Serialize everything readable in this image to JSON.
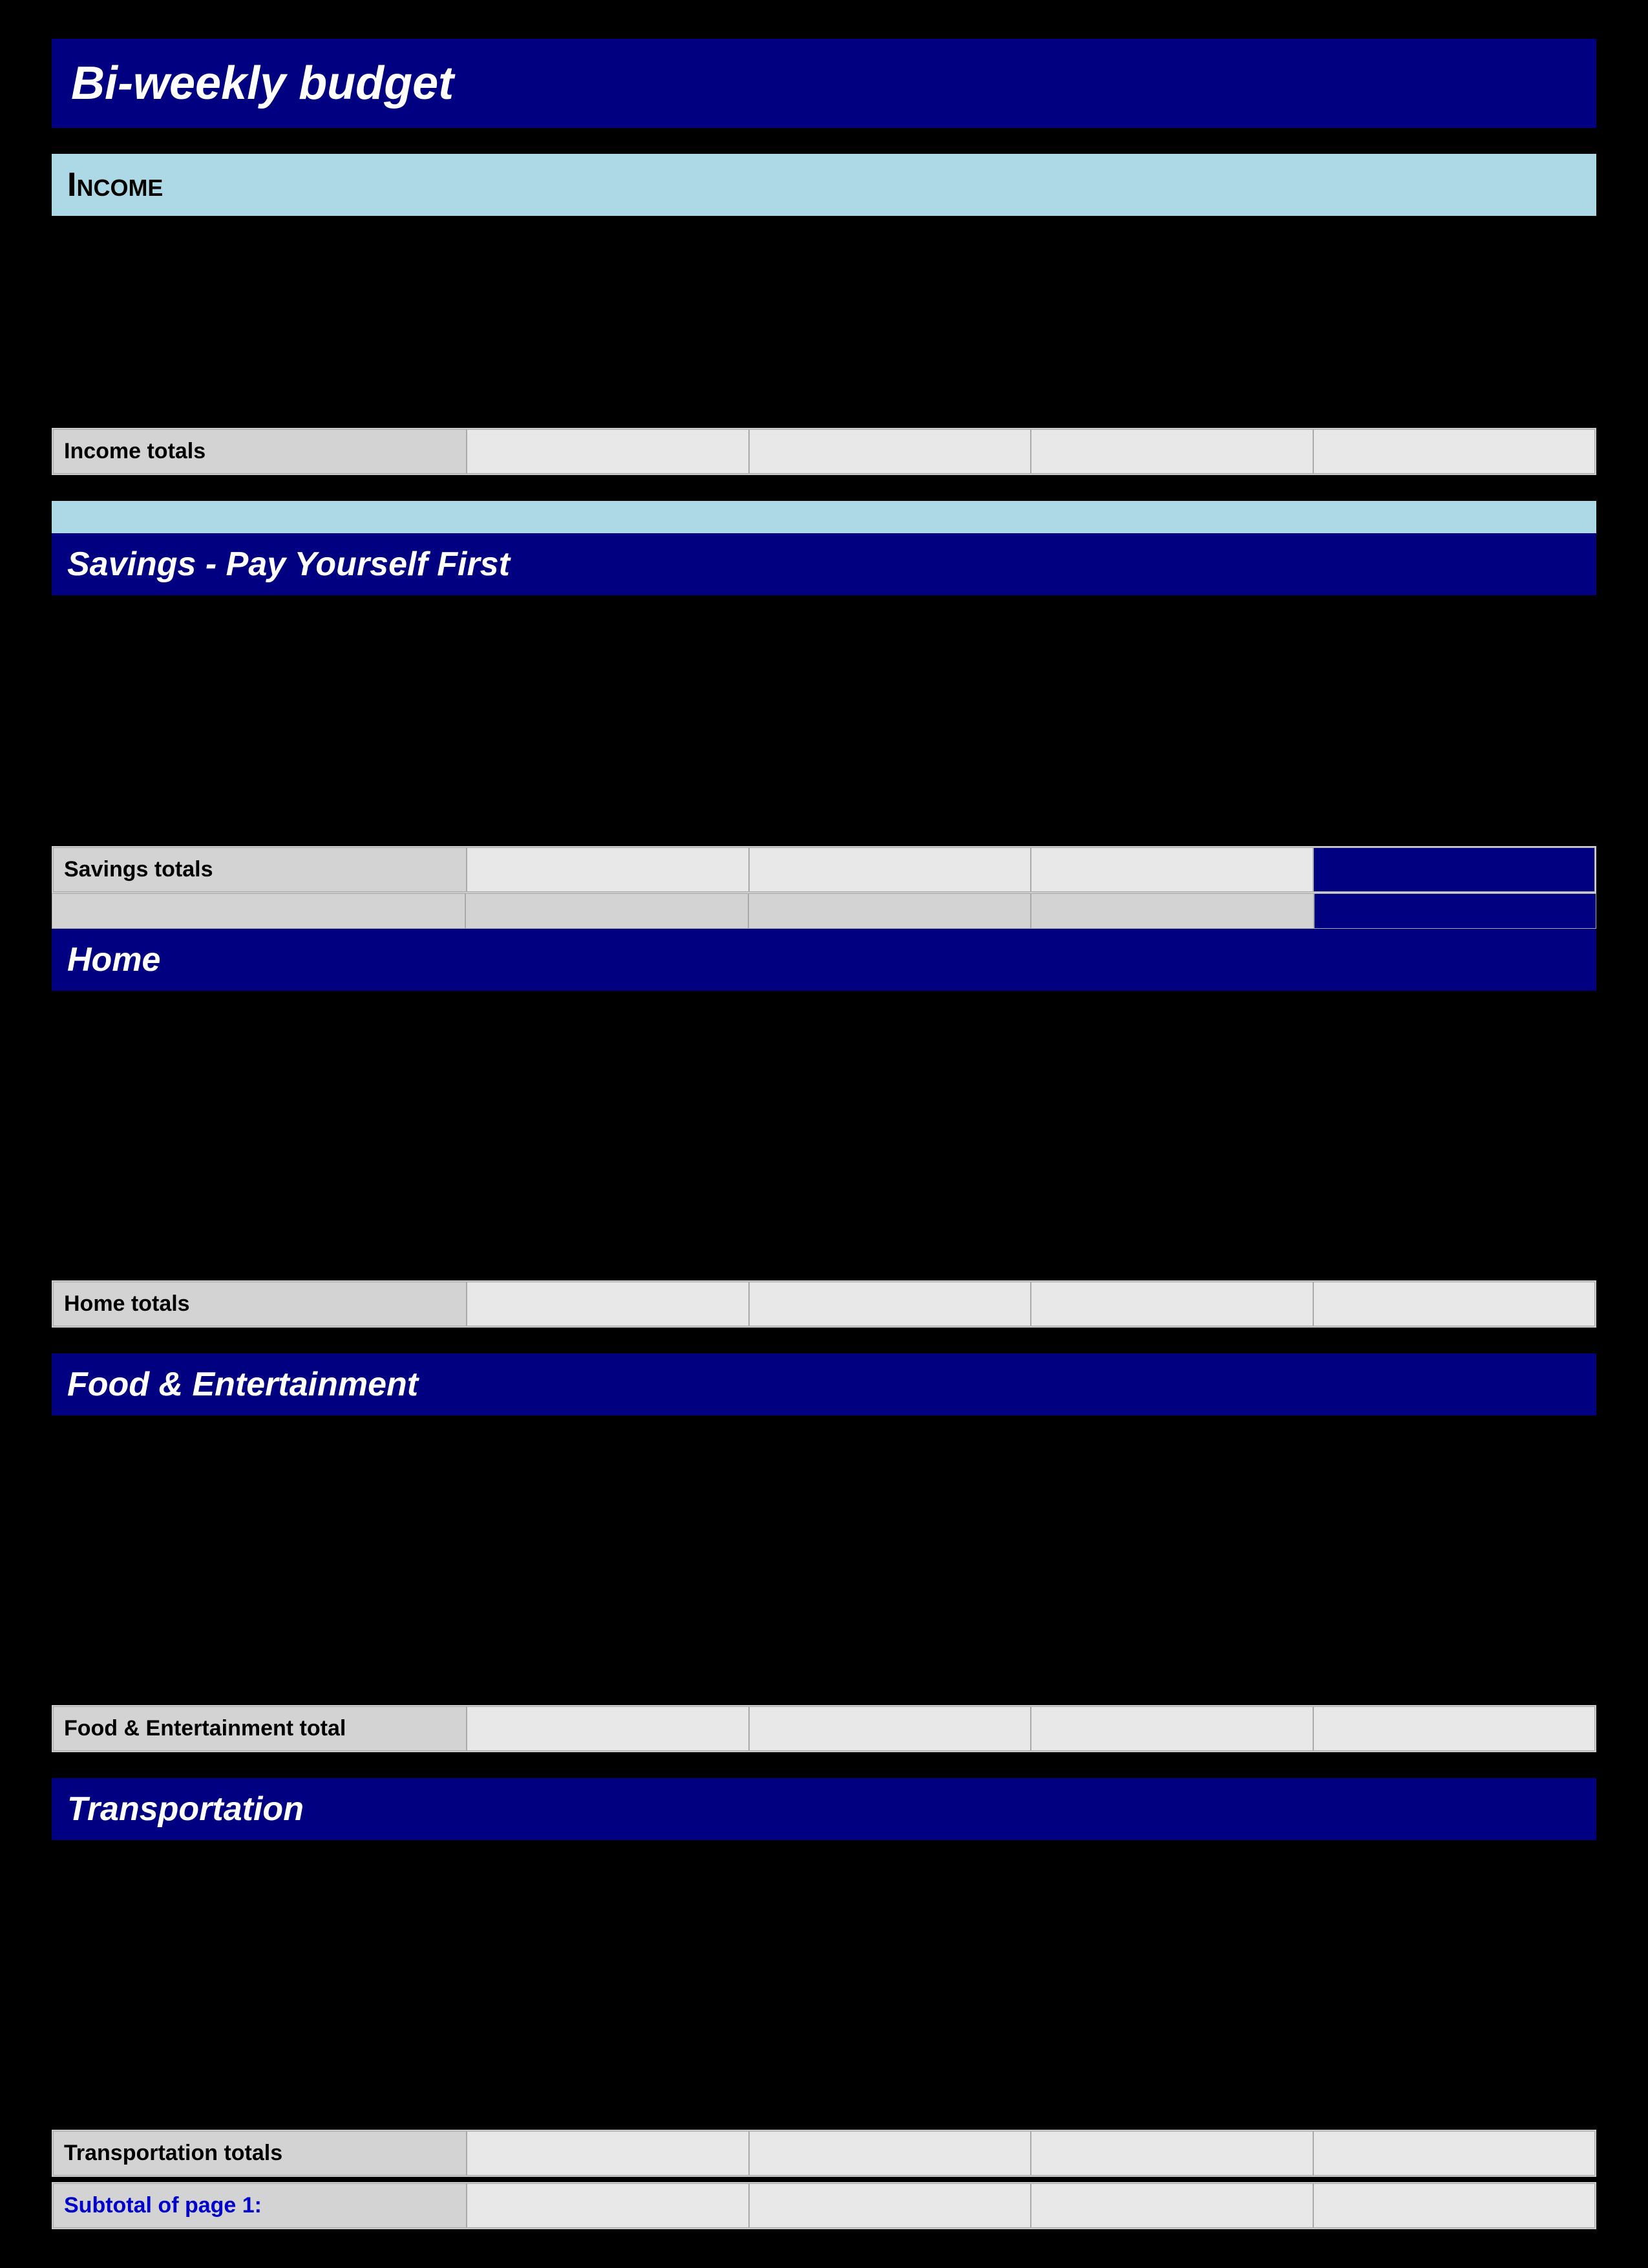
{
  "page": {
    "title": "Bi-weekly  budget",
    "background": "#000000"
  },
  "sections": {
    "income": {
      "label": "Income",
      "totals_label": "Income totals"
    },
    "savings": {
      "label": "Savings - Pay Yourself First",
      "totals_label": "Savings totals"
    },
    "home": {
      "label": "Home",
      "totals_label": "Home totals"
    },
    "food": {
      "label": "Food & Entertainment",
      "totals_label": "Food & Entertainment total"
    },
    "transportation": {
      "label": "Transportation",
      "totals_label": "Transportation totals"
    },
    "subtotal": {
      "label": "Subtotal of page 1:"
    }
  },
  "cells": {
    "empty": ""
  }
}
